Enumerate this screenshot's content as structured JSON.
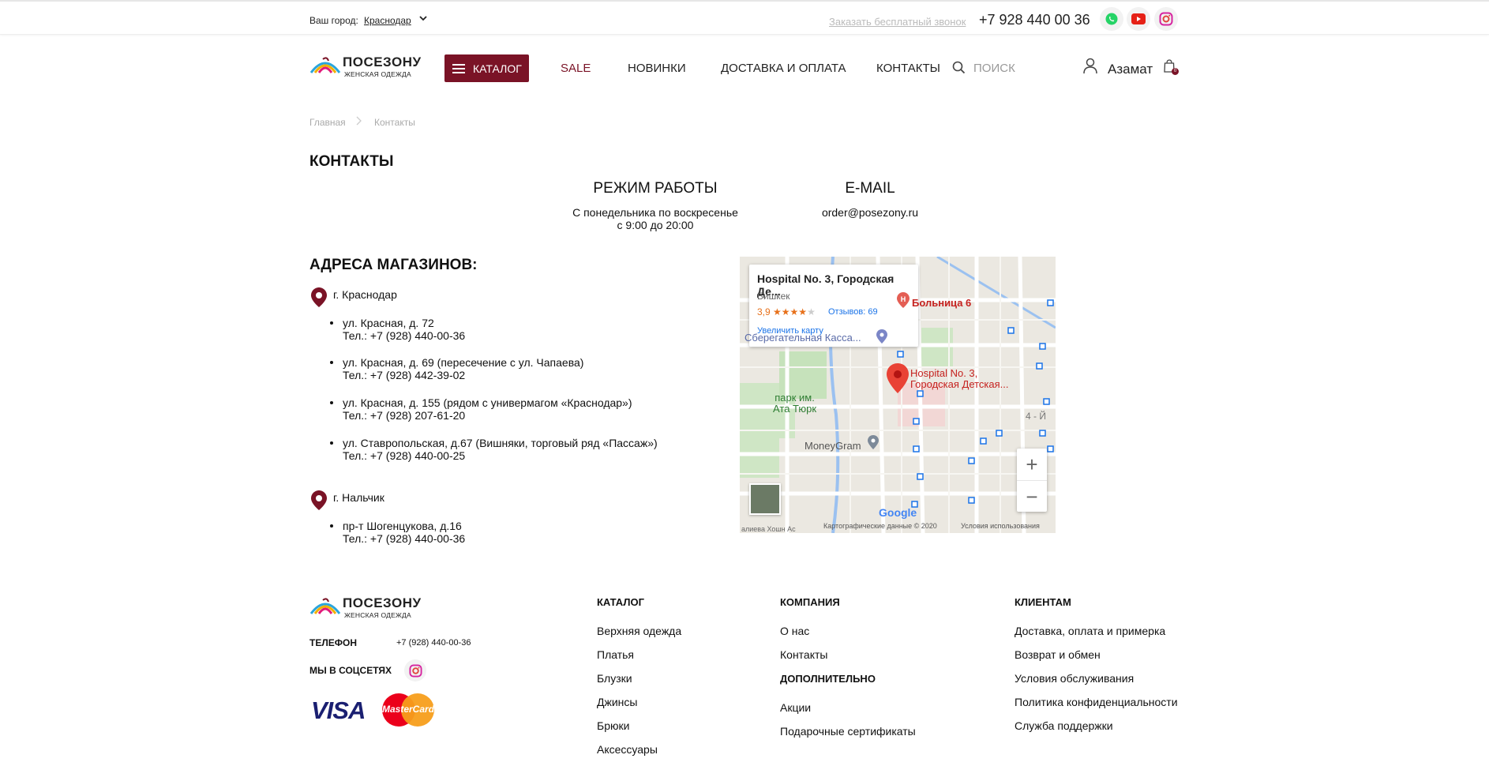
{
  "header": {
    "city_label": "Ваш город:",
    "city": "Краснодар",
    "callback": "Заказать бесплатный звонок",
    "phone": "+7 928 440 00 36",
    "social": [
      {
        "icon": "whatsapp-icon",
        "color": "#25d366"
      },
      {
        "icon": "youtube-icon",
        "color": "#e62117"
      },
      {
        "icon": "instagram-icon",
        "color": "#d6249f"
      }
    ]
  },
  "brand": {
    "name": "ПОСЕЗОНУ",
    "tagline": "ЖЕНСКАЯ ОДЕЖДА",
    "accent": "#7a1326"
  },
  "nav": {
    "catalog": "КАТАЛОГ",
    "items": [
      "SALE",
      "НОВИНКИ",
      "ДОСТАВКА И ОПЛАТА",
      "КОНТАКТЫ"
    ],
    "search_placeholder": "ПОИСК",
    "user": "Азамат",
    "cart_count": "0"
  },
  "breadcrumb": [
    "Главная",
    "Контакты"
  ],
  "page": {
    "title": "КОНТАКТЫ",
    "hours_title": "РЕЖИМ РАБОТЫ",
    "hours_line1": "С понедельника по воскресенье",
    "hours_line2": "с 9:00 до 20:00",
    "email_title": "E-MAIL",
    "email": "order@posezony.ru",
    "stores_title": "АДРЕСА МАГАЗИНОВ:"
  },
  "stores": [
    {
      "city": "г. Краснодар",
      "shops": [
        {
          "address": "ул. Красная, д. 72",
          "phone": "Тел.: +7 (928) 440-00-36"
        },
        {
          "address": "ул. Красная, д. 69 (пересечение с ул. Чапаева)",
          "phone": "Тел.: +7 (928) 442-39-02"
        },
        {
          "address": "ул. Красная, д. 155 (рядом с универмагом «Краснодар»)",
          "phone": "Тел.: +7 (928) 207-61-20"
        },
        {
          "address": "ул. Ставропольская, д.67 (Вишняки, торговый ряд «Пассаж»)",
          "phone": "Тел.: +7 (928) 440-00-25"
        }
      ]
    },
    {
      "city": "г. Нальчик",
      "shops": [
        {
          "address": "пр-т Шогенцукова, д.16",
          "phone": "Тел.: +7 (928) 440-00-36"
        }
      ]
    }
  ],
  "map": {
    "place_title": "Hospital No. 3, Городская Де...",
    "place_city": "Бишкек",
    "rating": "3,9",
    "stars": "★★★★",
    "star_empty": "★",
    "reviews": "Отзывов: 69",
    "enlarge": "Увеличить карту",
    "labels": {
      "hospital6": "Больница 6",
      "bank": "Сберегательная Касса...",
      "hospital3_l1": "Hospital No. 3,",
      "hospital3_l2": "Городская Детская...",
      "park_l1": "парк им.",
      "park_l2": "Ата Тюрк",
      "moneygram": "MoneyGram",
      "district": "4 - Й"
    },
    "zoom_in": "+",
    "zoom_out": "−",
    "google": "Google",
    "attribution": "Картографические данные © 2020",
    "terms": "Условия использования",
    "edge_text": "алиева   Хошн Ас"
  },
  "footer": {
    "phone_label": "ТЕЛЕФОН",
    "phone": "+7 (928) 440-00-36",
    "social_label": "МЫ В СОЦСЕТЯХ",
    "visa": "VISA",
    "mastercard": "MasterCard",
    "catalog": {
      "title": "КАТАЛОГ",
      "links": [
        "Верхняя одежда",
        "Платья",
        "Блузки",
        "Джинсы",
        "Брюки",
        "Аксессуары"
      ]
    },
    "company": {
      "title": "КОМПАНИЯ",
      "links": [
        "О нас",
        "Контакты"
      ]
    },
    "extra": {
      "title": "ДОПОЛНИТЕЛЬНО",
      "links": [
        "Акции",
        "Подарочные сертификаты"
      ]
    },
    "clients": {
      "title": "КЛИЕНТАМ",
      "links": [
        "Доставка, оплата и примерка",
        "Возврат и обмен",
        "Условия обслуживания",
        "Политика конфиденциальности",
        "Служба поддержки"
      ]
    }
  }
}
